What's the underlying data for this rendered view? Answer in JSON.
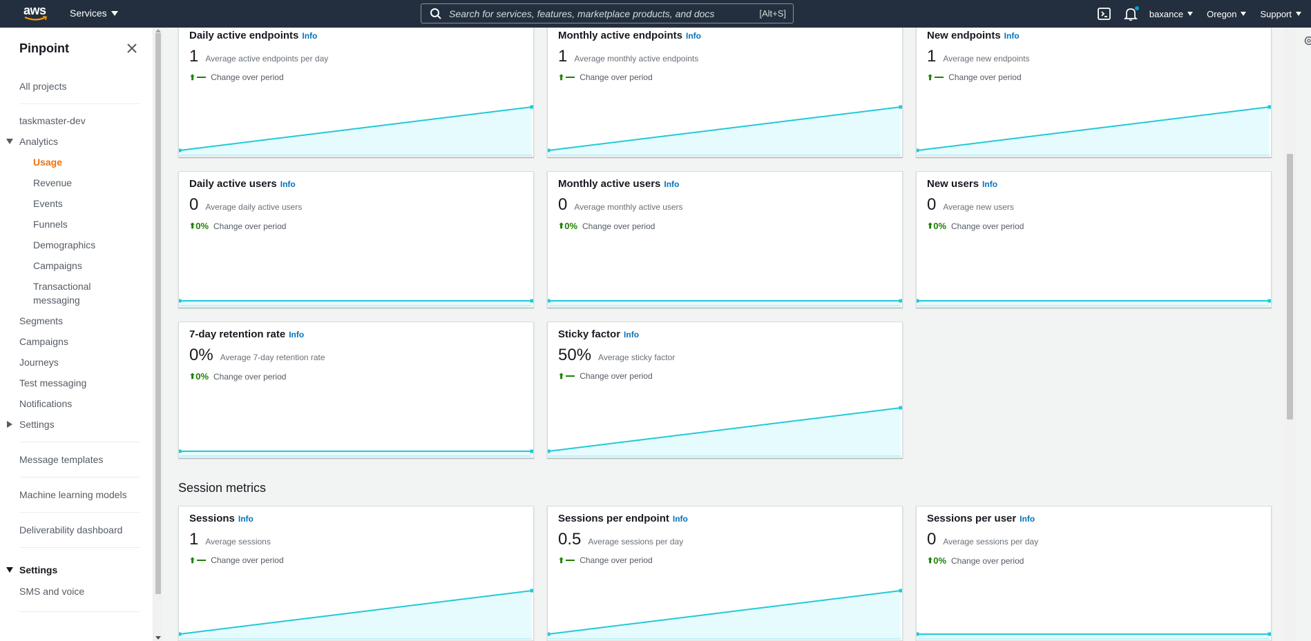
{
  "topnav": {
    "logo": "aws",
    "services": "Services",
    "search_placeholder": "Search for services, features, marketplace products, and docs",
    "search_shortcut": "[Alt+S]",
    "user": "baxance",
    "region": "Oregon",
    "support": "Support",
    "icons": [
      "cloudshell-icon",
      "bell-icon"
    ]
  },
  "sidebar": {
    "title": "Pinpoint",
    "all_projects": "All projects",
    "project": "taskmaster-dev",
    "analytics": "Analytics",
    "analytics_items": [
      "Usage",
      "Revenue",
      "Events",
      "Funnels",
      "Demographics",
      "Campaigns"
    ],
    "transactional_1": "Transactional",
    "transactional_2": "messaging",
    "items": [
      "Segments",
      "Campaigns",
      "Journeys",
      "Test messaging",
      "Notifications"
    ],
    "settings": "Settings",
    "message_templates": "Message templates",
    "ml_models": "Machine learning models",
    "deliverability": "Deliverability dashboard",
    "settings_section": "Settings",
    "sms_voice": "SMS and voice"
  },
  "info_label": "Info",
  "change_label": "Change over period",
  "section": {
    "session_metrics": "Session metrics"
  },
  "colors": {
    "accent": "#ec7211",
    "link": "#0073bb",
    "positive": "#1d8102",
    "spark_line": "#1fc9d9",
    "spark_fill": "#e6fbfd"
  },
  "cards": [
    {
      "title": "Daily active endpoints",
      "value": "1",
      "desc": "Average active endpoints per day",
      "change": "dash",
      "trend": "up"
    },
    {
      "title": "Monthly active endpoints",
      "value": "1",
      "desc": "Average monthly active endpoints",
      "change": "dash",
      "trend": "up"
    },
    {
      "title": "New endpoints",
      "value": "1",
      "desc": "Average new endpoints",
      "change": "dash",
      "trend": "up"
    },
    {
      "title": "Daily active users",
      "value": "0",
      "desc": "Average daily active users",
      "change": "0%",
      "trend": "flat"
    },
    {
      "title": "Monthly active users",
      "value": "0",
      "desc": "Average monthly active users",
      "change": "0%",
      "trend": "flat"
    },
    {
      "title": "New users",
      "value": "0",
      "desc": "Average new users",
      "change": "0%",
      "trend": "flat"
    },
    {
      "title": "7-day retention rate",
      "value": "0%",
      "desc": "Average 7-day retention rate",
      "change": "0%",
      "trend": "flat"
    },
    {
      "title": "Sticky factor",
      "value": "50%",
      "desc": "Average sticky factor",
      "change": "dash",
      "trend": "up"
    },
    {
      "title": "Sessions",
      "value": "1",
      "desc": "Average sessions",
      "change": "dash",
      "trend": "up"
    },
    {
      "title": "Sessions per endpoint",
      "value": "0.5",
      "desc": "Average sessions per day",
      "change": "dash",
      "trend": "up"
    },
    {
      "title": "Sessions per user",
      "value": "0",
      "desc": "Average sessions per day",
      "change": "0%",
      "trend": "flat"
    }
  ]
}
